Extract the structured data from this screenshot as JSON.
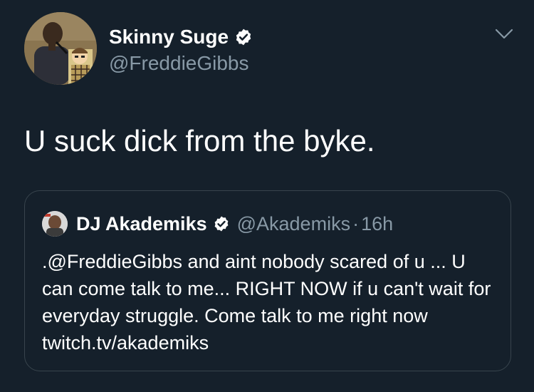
{
  "tweet": {
    "display_name": "Skinny Suge",
    "handle": "@FreddieGibbs",
    "text": "U suck dick from the byke."
  },
  "quoted_tweet": {
    "display_name": "DJ Akademiks",
    "handle": "@Akademiks",
    "separator": "·",
    "time": "16h",
    "text": ".@FreddieGibbs and aint nobody scared of u ... U can come talk to me... RIGHT NOW if u can't wait for everyday struggle. Come talk to me right now twitch.tv/akademiks"
  },
  "colors": {
    "background": "#15202b",
    "verified_badge": "#ffffff",
    "secondary_text": "#8899a6",
    "border": "#38444d"
  },
  "icons": {
    "verified": "verified-badge-icon",
    "menu": "chevron-down-icon"
  }
}
